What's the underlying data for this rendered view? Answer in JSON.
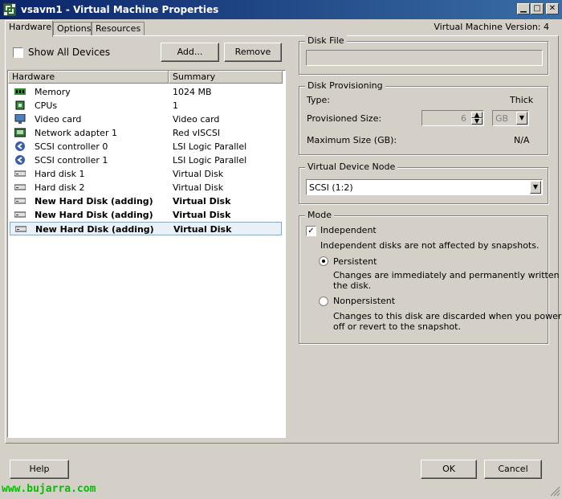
{
  "window": {
    "title": "vsavm1 - Virtual Machine Properties"
  },
  "tabs": [
    {
      "label": "Hardware"
    },
    {
      "label": "Options"
    },
    {
      "label": "Resources"
    }
  ],
  "version_label": "Virtual Machine Version: 4",
  "show_all_devices": {
    "label": "Show All Devices",
    "checked": false
  },
  "buttons": {
    "add": "Add...",
    "remove": "Remove",
    "help": "Help",
    "ok": "OK",
    "cancel": "Cancel"
  },
  "hardware_table": {
    "columns": [
      "Hardware",
      "Summary"
    ],
    "rows": [
      {
        "name": "Memory",
        "summary": "1024 MB",
        "icon": "memory-icon"
      },
      {
        "name": "CPUs",
        "summary": "1",
        "icon": "cpu-icon"
      },
      {
        "name": "Video card",
        "summary": "Video card",
        "icon": "monitor-icon"
      },
      {
        "name": "Network adapter 1",
        "summary": "Red vISCSI",
        "icon": "network-adapter-icon"
      },
      {
        "name": "SCSI controller 0",
        "summary": "LSI Logic Parallel",
        "icon": "scsi-controller-icon"
      },
      {
        "name": "SCSI controller 1",
        "summary": "LSI Logic Parallel",
        "icon": "scsi-controller-icon"
      },
      {
        "name": "Hard disk 1",
        "summary": "Virtual Disk",
        "icon": "hard-disk-icon"
      },
      {
        "name": "Hard disk 2",
        "summary": "Virtual Disk",
        "icon": "hard-disk-icon"
      },
      {
        "name": "New Hard Disk (adding)",
        "summary": "Virtual Disk",
        "icon": "hard-disk-icon"
      },
      {
        "name": "New Hard Disk (adding)",
        "summary": "Virtual Disk",
        "icon": "hard-disk-icon"
      },
      {
        "name": "New Hard Disk (adding)",
        "summary": "Virtual Disk",
        "icon": "hard-disk-icon"
      }
    ]
  },
  "disk_file": {
    "legend": "Disk File",
    "value": ""
  },
  "disk_provisioning": {
    "legend": "Disk Provisioning",
    "type_label": "Type:",
    "type_value": "Thick",
    "provisioned_label": "Provisioned Size:",
    "provisioned_value": "6",
    "unit": "GB",
    "max_label": "Maximum Size (GB):",
    "max_value": "N/A"
  },
  "virtual_device_node": {
    "legend": "Virtual Device Node",
    "value": "SCSI (1:2)"
  },
  "mode": {
    "legend": "Mode",
    "independent_label": "Independent",
    "independent_checked": true,
    "independent_desc": "Independent disks are not affected by snapshots.",
    "persistent_label": "Persistent",
    "persistent_desc_1": "Changes are immediately and permanently written to",
    "persistent_desc_2": "the disk.",
    "nonpersistent_label": "Nonpersistent",
    "nonpersistent_desc_1": "Changes to this disk are discarded when you power",
    "nonpersistent_desc_2": "off or revert to the snapshot.",
    "selected": "Persistent"
  },
  "watermark": "www.bujarra.com",
  "colors": {
    "titlebar_start": "#0a246a",
    "titlebar_end": "#3a6ea5",
    "dialog_bg": "#d4d0c8",
    "watermark": "#00c000"
  }
}
